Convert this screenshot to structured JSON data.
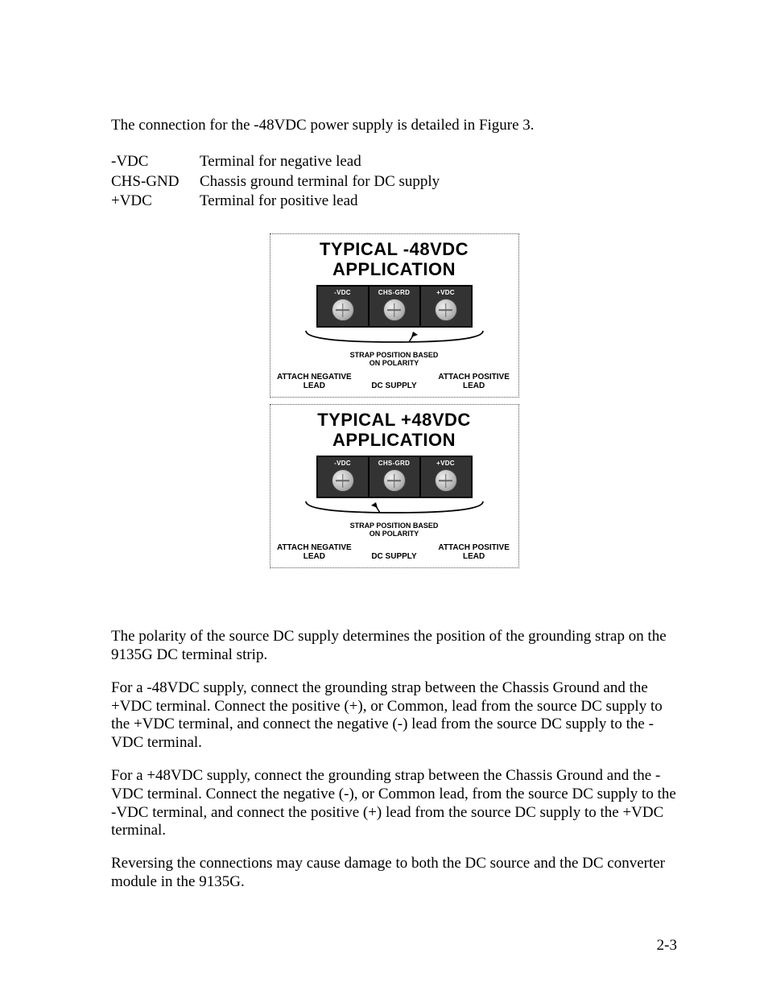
{
  "intro": "The connection for the -48VDC power supply is detailed in Figure 3.",
  "defs": [
    {
      "term": "-VDC",
      "desc": "Terminal for negative lead"
    },
    {
      "term": "CHS-GND",
      "desc": "Chassis ground terminal for DC supply"
    },
    {
      "term": "+VDC",
      "desc": "Terminal for positive lead"
    }
  ],
  "figure": {
    "blocks": [
      {
        "title_l1": "TYPICAL -48VDC",
        "title_l2": "APPLICATION",
        "terminals": [
          "-VDC",
          "CHS-GRD",
          "+VDC"
        ],
        "strap_note_l1": "STRAP POSITION BASED",
        "strap_note_l2": "ON POLARITY",
        "attach_neg_l1": "ATTACH NEGATIVE",
        "attach_neg_l2": "LEAD",
        "dc_supply": "DC SUPPLY",
        "attach_pos_l1": "ATTACH POSITIVE",
        "attach_pos_l2": "LEAD",
        "strap_side": "right"
      },
      {
        "title_l1": "TYPICAL +48VDC",
        "title_l2": "APPLICATION",
        "terminals": [
          "-VDC",
          "CHS-GRD",
          "+VDC"
        ],
        "strap_note_l1": "STRAP POSITION BASED",
        "strap_note_l2": "ON POLARITY",
        "attach_neg_l1": "ATTACH NEGATIVE",
        "attach_neg_l2": "LEAD",
        "dc_supply": "DC SUPPLY",
        "attach_pos_l1": "ATTACH POSITIVE",
        "attach_pos_l2": "LEAD",
        "strap_side": "left"
      }
    ]
  },
  "paras": [
    "The polarity of the source DC supply determines the position of the grounding strap on the 9135G DC terminal strip.",
    "For a -48VDC supply, connect the grounding strap between the Chassis Ground and the +VDC terminal. Connect the positive (+), or Common, lead from the source DC supply to the +VDC terminal, and connect the negative (-) lead from the source DC supply to the -VDC terminal.",
    "For a +48VDC supply, connect the grounding strap between the Chassis Ground and the -VDC terminal. Connect the negative (-), or Common lead, from the source DC supply to the -VDC terminal, and connect the positive (+) lead from the source DC supply to the +VDC terminal.",
    "Reversing the connections may cause damage to both the DC source and the DC converter module in the 9135G."
  ],
  "page_number": "2-3"
}
